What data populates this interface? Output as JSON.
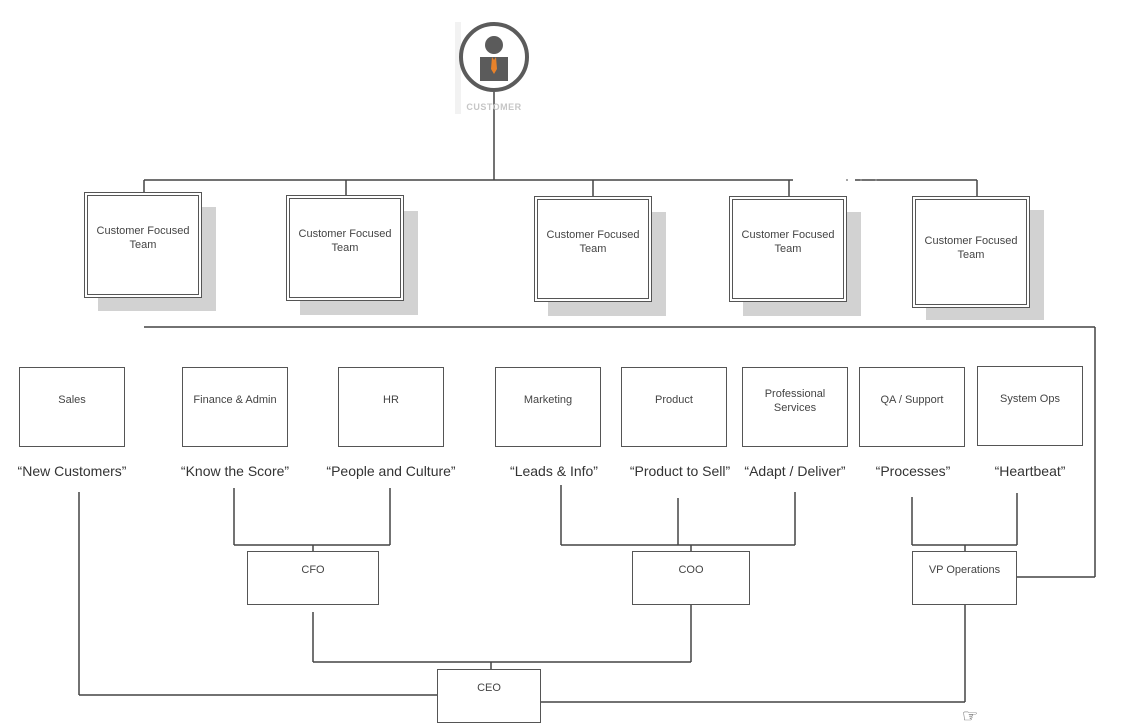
{
  "customer": {
    "label": "CUSTOMER",
    "icon": "customer-person-icon",
    "tie_color": "#e8822a",
    "icon_color": "#5b5b5b"
  },
  "teams": [
    {
      "label": "Customer Focused Team"
    },
    {
      "label": "Customer Focused Team"
    },
    {
      "label": "Customer Focused Team"
    },
    {
      "label": "Customer Focused Team"
    },
    {
      "label": "Customer Focused Team"
    }
  ],
  "departments": [
    {
      "name": "Sales",
      "tagline": "“New Customers”"
    },
    {
      "name": "Finance & Admin",
      "tagline": "“Know the Score”"
    },
    {
      "name": "HR",
      "tagline": "“People and Culture”"
    },
    {
      "name": "Marketing",
      "tagline": "“Leads & Info”"
    },
    {
      "name": "Product",
      "tagline": "“Product to Sell”"
    },
    {
      "name": "Professional Services",
      "tagline": "“Adapt / Deliver”"
    },
    {
      "name": "QA / Support",
      "tagline": "“Processes”"
    },
    {
      "name": "System Ops",
      "tagline": "“Heartbeat”"
    }
  ],
  "executives": {
    "cfo": "CFO",
    "coo": "COO",
    "vp_ops": "VP Operations",
    "ceo": "CEO"
  },
  "cursor": {
    "icon": "pointing-hand-cursor-icon",
    "glyph": "☞"
  }
}
